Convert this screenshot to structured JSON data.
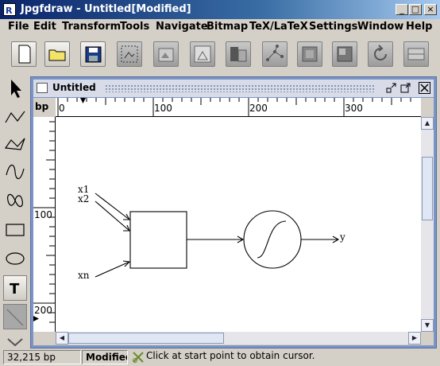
{
  "window": {
    "title": "Jpgfdraw - Untitled[Modified]",
    "controls": [
      "_",
      "□",
      "×"
    ]
  },
  "menu": [
    "File",
    "Edit",
    "Transform",
    "Tools",
    "Navigate",
    "Bitmap",
    "TeX/LaTeX",
    "Settings",
    "Window",
    "Help"
  ],
  "toolbar": {
    "buttons": [
      "new-file",
      "open-folder",
      "save-disk",
      "select-region",
      "bitmap-edit",
      "bitmap-group",
      "bitmap-copy",
      "graph-node",
      "construct-a",
      "construct-b",
      "rotate",
      "tile-split"
    ]
  },
  "palette": {
    "tools": [
      "select-arrow",
      "open-polyline",
      "closed-polyline",
      "open-curve",
      "closed-curve",
      "rectangle",
      "ellipse",
      "text",
      "math-text"
    ]
  },
  "document": {
    "title": "Untitled",
    "ruler_unit": "bp",
    "top_ruler_labels": [
      "0",
      "100",
      "200",
      "300"
    ],
    "left_ruler_labels": [
      "100",
      "200"
    ],
    "labels": {
      "x1": "x1",
      "x2": "x2",
      "xn": "xn",
      "y": "y"
    }
  },
  "status": {
    "coordinates": "32,215 bp",
    "state": "Modified",
    "message": "Click at start point to obtain cursor."
  },
  "colors": {
    "titlebar_start": "#0a246a",
    "frame_border": "#7b94c6"
  }
}
